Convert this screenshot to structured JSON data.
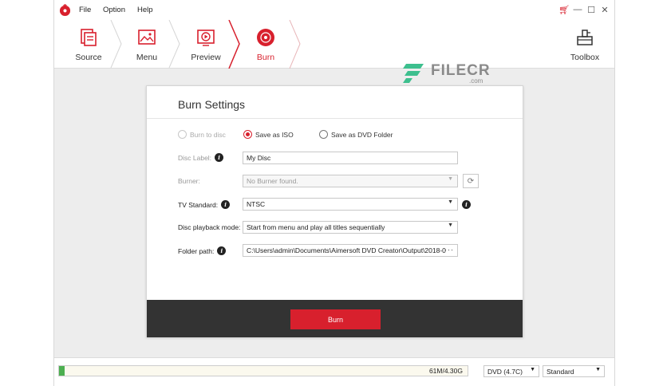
{
  "menu": {
    "file": "File",
    "option": "Option",
    "help": "Help"
  },
  "steps": [
    {
      "label": "Source",
      "icon": "source-icon",
      "active": false
    },
    {
      "label": "Menu",
      "icon": "menu-template-icon",
      "active": false
    },
    {
      "label": "Preview",
      "icon": "preview-icon",
      "active": false
    },
    {
      "label": "Burn",
      "icon": "burn-disc-icon",
      "active": true
    }
  ],
  "toolbox": {
    "label": "Toolbox",
    "icon": "toolbox-icon"
  },
  "watermark": {
    "text": "FILECR",
    "suffix": ".com"
  },
  "burn_settings": {
    "title": "Burn Settings",
    "output_options": [
      {
        "label": "Burn to disc",
        "selected": false,
        "disabled": true
      },
      {
        "label": "Save as ISO",
        "selected": true,
        "disabled": false
      },
      {
        "label": "Save as DVD Folder",
        "selected": false,
        "disabled": false
      }
    ],
    "disc_label": {
      "label": "Disc Label:",
      "value": "My Disc"
    },
    "burner": {
      "label": "Burner:",
      "value": "No Burner found."
    },
    "tv_standard": {
      "label": "TV Standard:",
      "value": "NTSC"
    },
    "playback_mode": {
      "label": "Disc playback mode:",
      "value": "Start from menu and play all titles sequentially"
    },
    "folder_path": {
      "label": "Folder path:",
      "value": "C:\\Users\\admin\\Documents\\Aimersoft DVD Creator\\Output\\2018-0",
      "more": "···"
    },
    "burn_button": "Burn"
  },
  "status": {
    "usage_text": "61M/4.30G",
    "usage_fraction": 0.014,
    "disc_type": "DVD (4.7C)",
    "quality": "Standard"
  },
  "colors": {
    "accent": "#d8202d",
    "footer": "#333333",
    "progress": "#4caf50"
  }
}
